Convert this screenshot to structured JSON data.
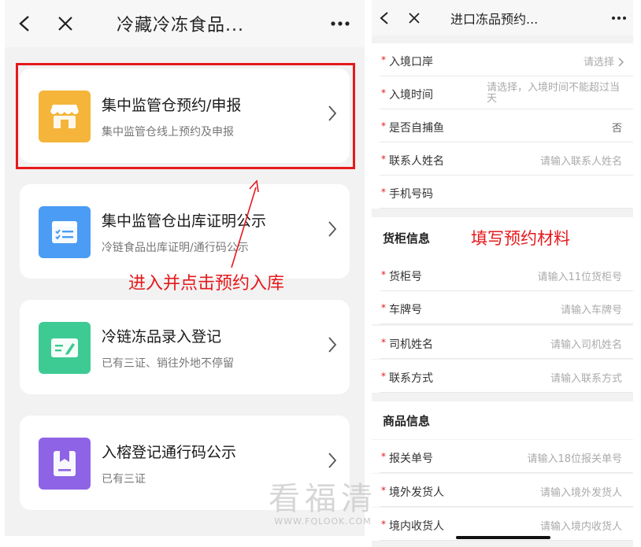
{
  "left": {
    "title": "冷藏冷冻食品...",
    "cards": [
      {
        "title": "集中监管仓预约/申报",
        "subtitle": "集中监管仓线上预约及申报",
        "icon": "store-icon",
        "color": "#f5b53a"
      },
      {
        "title": "集中监管仓出库证明公示",
        "subtitle": "冷链食品出库证明/通行码公示",
        "icon": "document-list-icon",
        "color": "#4a9cf5"
      },
      {
        "title": "冷链冻品录入登记",
        "subtitle": "已有三证、销往外地不停留",
        "icon": "edit-icon",
        "color": "#3ecb93"
      },
      {
        "title": "入榕登记通行码公示",
        "subtitle": "已有三证",
        "icon": "bookmark-icon",
        "color": "#8e63e6"
      }
    ],
    "annotation": "进入并点击预约入库"
  },
  "right": {
    "title": "进口冻品预约...",
    "rows_top": [
      {
        "label": "入境口岸",
        "value": "请选择",
        "chevron": true
      },
      {
        "label": "入境时间",
        "value": "请选择，入境时间不能超过当天"
      },
      {
        "label": "是否自捕鱼",
        "value": "否"
      },
      {
        "label": "联系人姓名",
        "value": "请输入联系人姓名"
      },
      {
        "label": "手机号码",
        "value": ""
      }
    ],
    "section_cabinet": "货柜信息",
    "annotation": "填写预约材料",
    "rows_cabinet": [
      {
        "label": "货柜号",
        "value": "请输入11位货柜号"
      },
      {
        "label": "车牌号",
        "value": "请输入车牌号"
      },
      {
        "label": "司机姓名",
        "value": "请输入司机姓名"
      },
      {
        "label": "联系方式",
        "value": "请输入联系方式"
      }
    ],
    "section_goods": "商品信息",
    "rows_goods": [
      {
        "label": "报关单号",
        "value": "请输入18位报关单号"
      },
      {
        "label": "境外发货人",
        "value": "请输入境外发货人"
      },
      {
        "label": "境内收货人",
        "value": "请输入境内收货人"
      }
    ]
  },
  "watermark": {
    "main": "看福清",
    "sub": "WWW.FQLOOK.COM"
  },
  "colors": {
    "required": "#e5191c",
    "annotation": "#e5191c"
  }
}
